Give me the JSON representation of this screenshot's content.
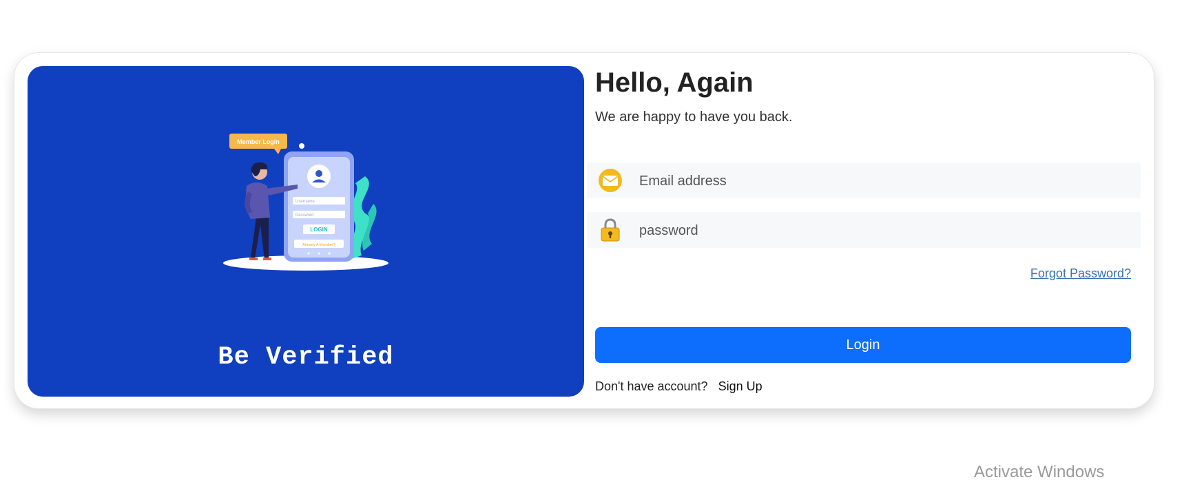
{
  "left_panel": {
    "tagline": "Be Verified",
    "illustration": {
      "bubble_text": "Member Login",
      "field_1": "Username",
      "field_2": "Password",
      "button": "LOGIN",
      "link": "Already A Member?"
    }
  },
  "form": {
    "title": "Hello, Again",
    "subtitle": "We are happy to have you back.",
    "email": {
      "placeholder": "Email address",
      "icon": "envelope-icon"
    },
    "password": {
      "placeholder": "password",
      "icon": "lock-icon"
    },
    "forgot_password": "Forgot Password?",
    "login_button": "Login",
    "no_account_text": "Don't have account?",
    "signup_link": "Sign Up"
  },
  "system": {
    "watermark": "Activate Windows"
  },
  "colors": {
    "panel_blue": "#1040bf",
    "button_blue": "#0d6efd",
    "field_bg": "#f7f8fa",
    "icon_yellow": "#f4b91f"
  }
}
